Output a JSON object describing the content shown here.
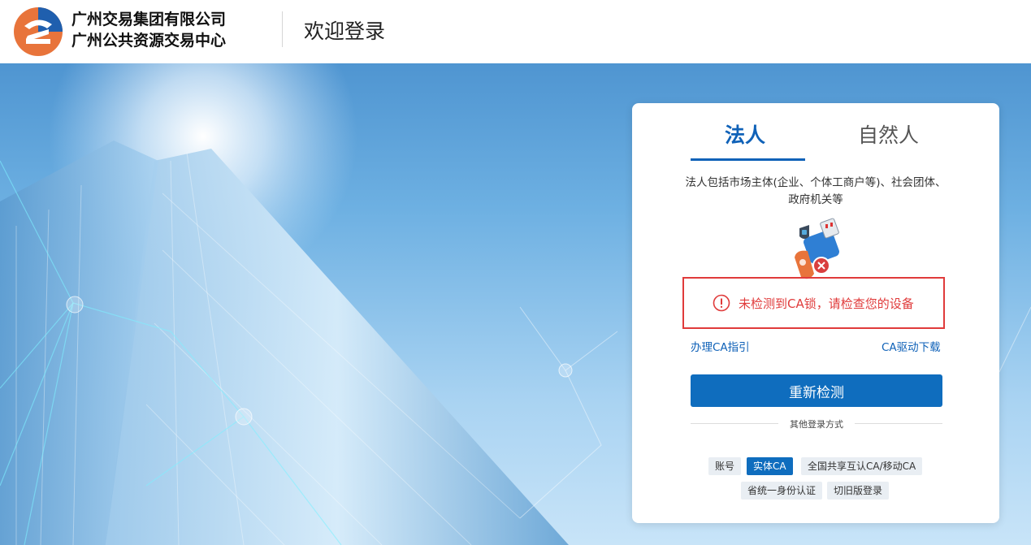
{
  "header": {
    "org_line1": "广州交易集团有限公司",
    "org_line2": "广州公共资源交易中心",
    "welcome": "欢迎登录"
  },
  "tabs": [
    {
      "label": "法人",
      "active": true
    },
    {
      "label": "自然人",
      "active": false
    }
  ],
  "description": "法人包括市场主体(企业、个体工商户等)、社会团体、政府机关等",
  "alert": {
    "icon": "exclamation-circle-icon",
    "text": "未检测到CA锁，请检查您的设备"
  },
  "links": {
    "guide": "办理CA指引",
    "driver": "CA驱动下载"
  },
  "retry_button": "重新检测",
  "other_methods": {
    "label": "其他登录方式",
    "chips": [
      {
        "label": "账号",
        "active": false
      },
      {
        "label": "实体CA",
        "active": true
      },
      {
        "label": "全国共享互认CA/移动CA",
        "active": false
      },
      {
        "label": "省统一身份认证",
        "active": false
      },
      {
        "label": "切旧版登录",
        "active": false
      }
    ]
  },
  "colors": {
    "brand_blue": "#0f6dbe",
    "tab_blue": "#1062b8",
    "alert_red": "#e03b3b",
    "logo_orange": "#e8743b"
  }
}
